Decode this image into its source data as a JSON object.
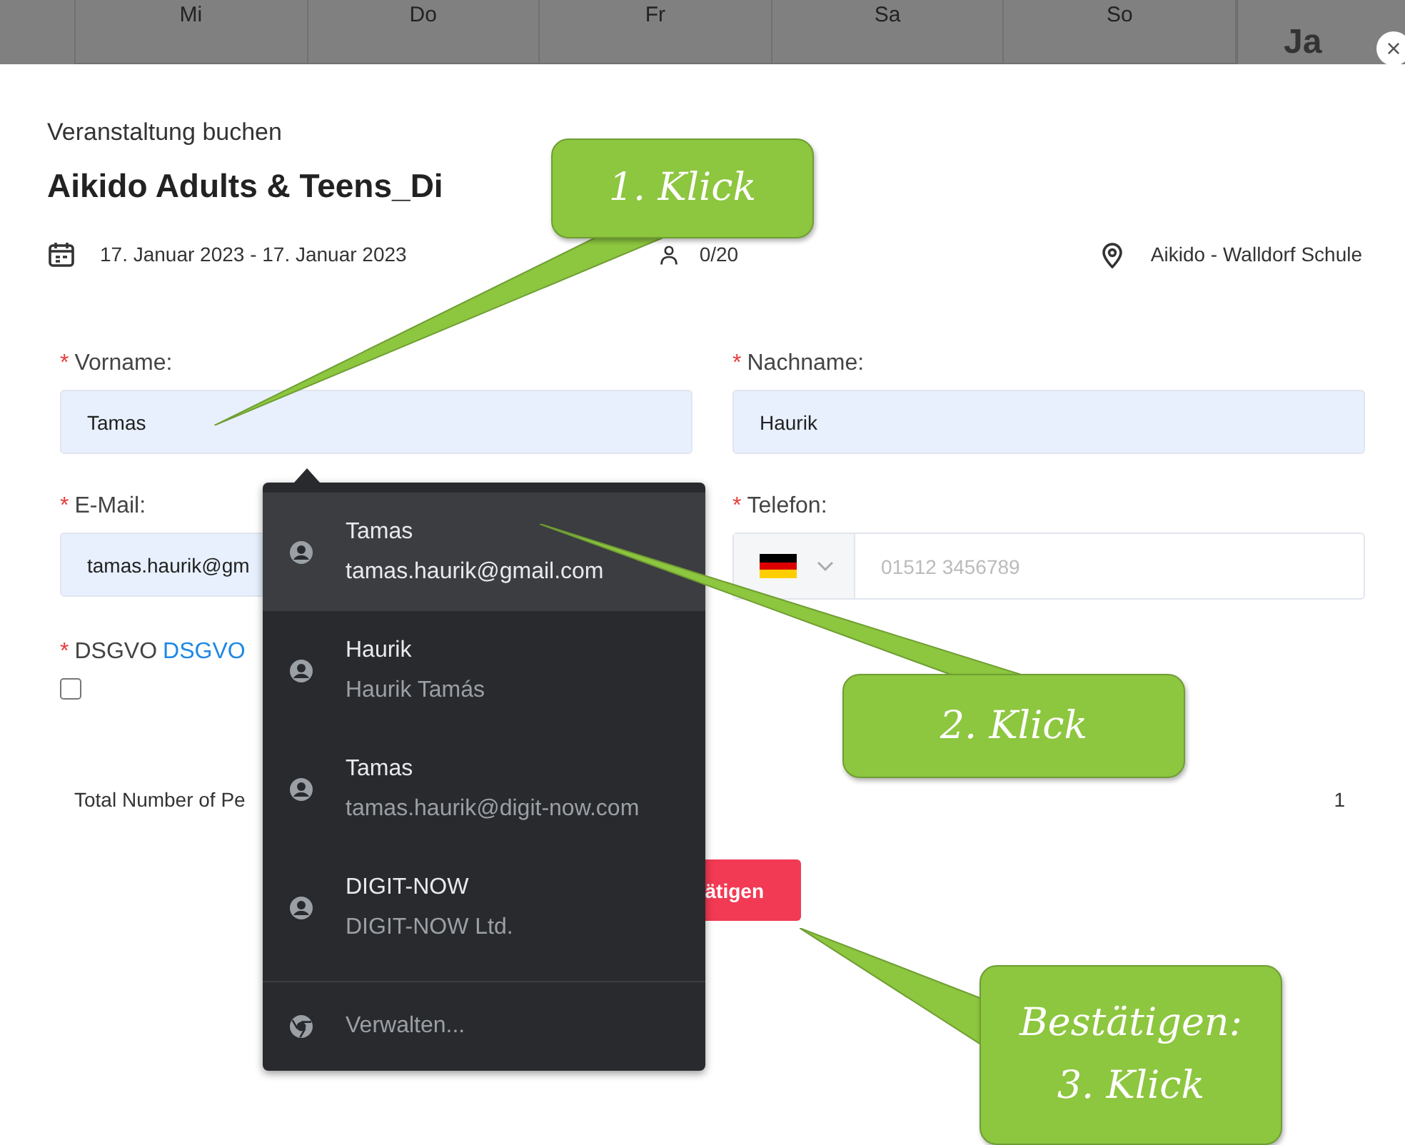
{
  "calendar": {
    "weekdays": [
      "Mi",
      "Do",
      "Fr",
      "Sa",
      "So"
    ],
    "month_title": "Ja",
    "close_label": "×"
  },
  "modal": {
    "subtitle": "Veranstaltung buchen",
    "title": "Aikido Adults & Teens_Di",
    "date": "17. Januar 2023 - 17. Januar 2023",
    "capacity": "0/20",
    "location": "Aikido - Walldorf Schule"
  },
  "fields": [
    {
      "kind": "text",
      "required_mark": "*",
      "label": "Vorname:",
      "value": "Tamas",
      "autofilled": true
    },
    {
      "kind": "text",
      "required_mark": "*",
      "label": "Nachname:",
      "value": "Haurik",
      "autofilled": true
    },
    {
      "kind": "text",
      "required_mark": "*",
      "label": "E-Mail:",
      "value": "tamas.haurik@gm",
      "autofilled": true
    },
    {
      "kind": "phone",
      "required_mark": "*",
      "label": "Telefon:",
      "placeholder": "01512 3456789"
    }
  ],
  "consent": {
    "required_mark": "*",
    "label": "DSGVO",
    "link": "DSGVO",
    "checked": false
  },
  "total": {
    "label": "Total Number of Pe",
    "value": "1"
  },
  "confirm_button": "ätigen",
  "autocomplete": {
    "items": [
      {
        "name": "Tamas",
        "detail": "tamas.haurik@gmail.com",
        "selected": true
      },
      {
        "name": "Haurik",
        "detail": "Haurik Tamás",
        "selected": false
      },
      {
        "name": "Tamas",
        "detail": "tamas.haurik@digit-now.com",
        "selected": false
      },
      {
        "name": "DIGIT-NOW",
        "detail": "DIGIT-NOW Ltd.",
        "selected": false
      }
    ],
    "footer": "Verwalten..."
  },
  "callouts": [
    {
      "lines": [
        "1. Klick"
      ]
    },
    {
      "lines": [
        "2. Klick"
      ]
    },
    {
      "lines": [
        "Bestätigen:",
        "3. Klick"
      ]
    }
  ]
}
